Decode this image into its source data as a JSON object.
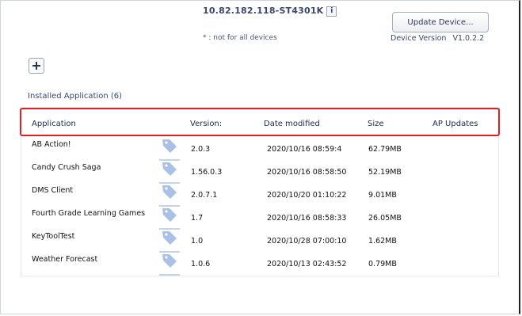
{
  "device": {
    "title": "10.82.182.118-ST4301K",
    "info_icon": "i",
    "note": "* : not for all devices",
    "update_button": "Update Device...",
    "version_label": "Device Version",
    "version_value": "V1.0.2.2"
  },
  "apps": {
    "installed_label": "Installed Application (6)",
    "columns": {
      "application": "Application",
      "version": "Version:",
      "date_modified": "Date modified",
      "size": "Size",
      "ap_updates": "AP Updates"
    },
    "rows": [
      {
        "name": "AB Action!",
        "version": "2.0.3",
        "date": "2020/10/16 08:59:4",
        "size": "62.79MB"
      },
      {
        "name": "Candy Crush Saga",
        "version": "1.56.0.3",
        "date": "2020/10/16 08:58:50",
        "size": "52.19MB"
      },
      {
        "name": "DMS Client",
        "version": "2.0.7.1",
        "date": "2020/10/20 01:10:22",
        "size": "9.01MB"
      },
      {
        "name": "Fourth Grade Learning Games",
        "version": "1.7",
        "date": "2020/10/16 08:58:33",
        "size": "26.05MB"
      },
      {
        "name": "KeyToolTest",
        "version": "1.0",
        "date": "2020/10/28 07:00:10",
        "size": "1.62MB"
      },
      {
        "name": "Weather Forecast",
        "version": "1.0.6",
        "date": "2020/10/13 02:43:52",
        "size": "0.79MB"
      }
    ]
  },
  "colors": {
    "highlight": "#e02020",
    "tag_icon": "#a9c1e6"
  }
}
